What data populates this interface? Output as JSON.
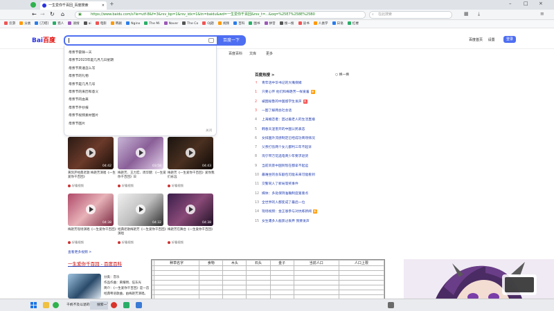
{
  "browser": {
    "tab_title": "一生爱你千百回_百度搜索",
    "url": "https://www.baidu.com/s?ie=utf-8&f=3&rsv_bp=1&rsv_idx=1&tn=baidu&wd=一生爱你千百回&rsv_t=...&oq=%25E7%258E%25B0",
    "search_placeholder": "在此搜索",
    "bookmarks": [
      "云游",
      "分类",
      "[刀塔]",
      "猎人",
      "速搜",
      "ai",
      "电影",
      "韩剧",
      "Nginx",
      "The Mi",
      "Naver",
      "The Co",
      "OJ题",
      "视频",
      "百科",
      "图书",
      "拼音",
      "搜一搜",
      "读书",
      "人类学",
      "日语",
      "红楼"
    ]
  },
  "baidu": {
    "logo_main": "Bai",
    "logo_accent": "百度",
    "search_button": "百度一下",
    "top_links": [
      "百度首页",
      "设置"
    ],
    "login": "登录",
    "sub_nav": [
      "百度百科",
      "文库",
      "更多"
    ],
    "suggestions": [
      "母亲节雷锋一天",
      "母亲节2023年是几月几日星期",
      "母亲节英语怎么写",
      "母亲节的礼物",
      "母亲节是几月几号",
      "母亲节的来历和意义",
      "母亲节的由来",
      "母亲节手抄报",
      "母亲节视频素材图片",
      "母亲节图片"
    ],
    "suggest_close": "关闭",
    "videos": [
      {
        "duration": "04:42",
        "caption": "黄凯芹经典老歌 梅艳芳演唱《一生爱你千百回》",
        "source": "好看视频"
      },
      {
        "duration": "03:58",
        "caption": "梅艳芳、王力宏、周华健：《一生爱你千百回》日",
        "source": "好看视频"
      },
      {
        "duration": "04:43",
        "caption": "梅艳芳《一生爱你千百回》爱你我们永远",
        "source": "好看视频"
      },
      {
        "duration": "04:38",
        "caption": "梅艳芳现场演唱《一生爱你千百回》",
        "source": "好看视频"
      },
      {
        "duration": "04:32",
        "caption": "经典老歌梅艳芳《一生爱你千百回》演唱",
        "source": "好看视频"
      },
      {
        "duration": "04:38",
        "caption": "梅艳芳在舞台《一生爱你千百回》",
        "source": "好看视频"
      }
    ],
    "more_videos": "查看更多视频 >",
    "baike_title_accent": "一生爱你千百回",
    "baike_title_rest": " - 百度百科",
    "baike_lines": [
      "分类：音乐",
      "作品作曲：黄耀明、伍东光",
      "简介：《一生爱你千百回》是一首",
      "经典粤语歌曲，由梅艳芳演唱。"
    ],
    "hot_title": "百度热搜 >",
    "hot_refresh": "换一换",
    "hot_items": [
      {
        "n": "↑",
        "text": "青年话中华书记的大嘴保姆",
        "badge": ""
      },
      {
        "n": "1",
        "text": "只要心怀 他们和梅艳芳一样爱着",
        "badge": "新"
      },
      {
        "n": "2",
        "text": "被困秘鲁的中国留学生发声",
        "badge": "热"
      },
      {
        "n": "3",
        "text": "一图了解两会社会话",
        "badge": ""
      },
      {
        "n": "4",
        "text": "上海婚恋者：因过着老人的生活直播",
        "badge": ""
      },
      {
        "n": "5",
        "text": "韩春天湿害开的中国公民表态",
        "badge": ""
      },
      {
        "n": "6",
        "text": "女排国外流感制定已经成功商场情况",
        "badge": ""
      },
      {
        "n": "7",
        "text": "父亲打伤两个女儿都判三年不起诉",
        "badge": ""
      },
      {
        "n": "8",
        "text": "淘宁带万花选电商少年要求退货",
        "badge": ""
      },
      {
        "n": "9",
        "text": "当前风景中国到现在都拿不起运",
        "badge": ""
      },
      {
        "n": "10",
        "text": "最难坐的会车剧包可能未来可能看到",
        "badge": ""
      },
      {
        "n": "11",
        "text": "交警同人了新局等奖事件",
        "badge": ""
      },
      {
        "n": "12",
        "text": "媒体：多处保持准确制度第重点",
        "badge": ""
      },
      {
        "n": "13",
        "text": "全世界的人都变成了最后一位",
        "badge": ""
      },
      {
        "n": "14",
        "text": "现场视频：金正恩参与对抗练新闻",
        "badge": "新"
      },
      {
        "n": "15",
        "text": "女生遭多人截获过丢弃 我要发声",
        "badge": ""
      }
    ]
  },
  "sheet": {
    "headers": [
      "",
      "种草名字",
      "食物",
      "木头",
      "石头",
      "金子",
      "当前人口",
      "人口上限"
    ]
  },
  "taskbar": {
    "items": [
      "千帆不及以退的你",
      "搜索一下"
    ]
  }
}
